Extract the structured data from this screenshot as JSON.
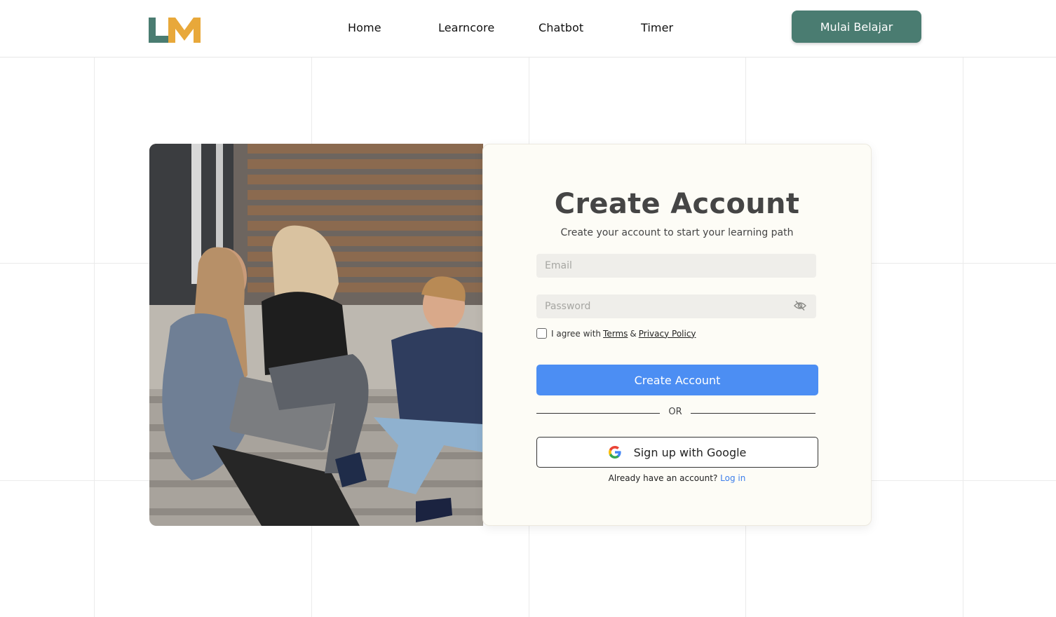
{
  "nav": {
    "logo_text": "LM",
    "links": [
      "Home",
      "Learncore",
      "Chatbot",
      "Timer"
    ],
    "cta_label": "Mulai Belajar"
  },
  "form": {
    "title": "Create Account",
    "subtitle": "Create your account to start your learning path",
    "email_placeholder": "Email",
    "password_placeholder": "Password",
    "agree_prefix": "I agree with",
    "terms_label": "Terms",
    "amp": "&",
    "privacy_label": "Privacy Policy",
    "submit_label": "Create Account",
    "or_label": "OR",
    "google_label": "Sign up with Google",
    "already_text": "Already have an account?",
    "login_label": "Log in"
  },
  "colors": {
    "brand_green": "#4a7c71",
    "brand_gold": "#e8a83a",
    "primary_blue": "#4c8ef3",
    "card_bg": "#fdfcf6"
  },
  "icons": [
    "logo-icon",
    "eye-off-icon",
    "google-icon"
  ]
}
